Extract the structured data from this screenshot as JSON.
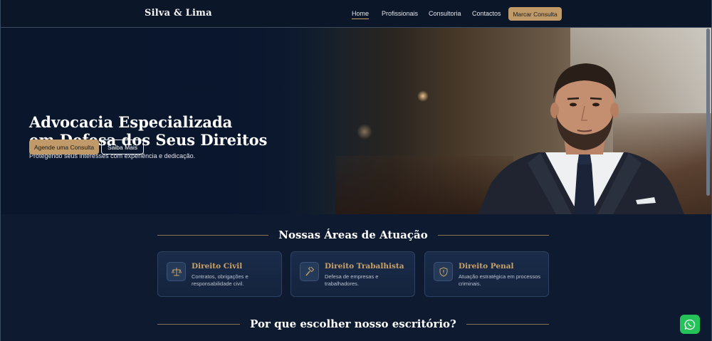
{
  "nav": {
    "brand": "Silva & Lima",
    "links": [
      {
        "label": "Home",
        "active": true
      },
      {
        "label": "Profissionais",
        "active": false
      },
      {
        "label": "Consultoria",
        "active": false
      },
      {
        "label": "Contactos",
        "active": false
      }
    ],
    "cta": "Marcar Consulta"
  },
  "hero": {
    "title_line1": "Advocacia Especializada",
    "title_line2": "em Defesa dos Seus Direitos",
    "subtitle": "Protegendo seus interesses com experiência e dedicação.",
    "primary_button": "Agende uma Consulta",
    "secondary_button": "Saiba Mais"
  },
  "areas": {
    "heading": "Nossas Áreas de Atuação",
    "cards": [
      {
        "icon": "scales-icon",
        "title": "Direito Civil",
        "description": "Contratos, obrigações e responsabilidade civil."
      },
      {
        "icon": "gavel-icon",
        "title": "Direito Trabalhista",
        "description": "Defesa de empresas e trabalhadores."
      },
      {
        "icon": "shield-icon",
        "title": "Direito Penal",
        "description": "Atuação estratégica em processos criminais."
      }
    ]
  },
  "why": {
    "heading": "Por que escolher nosso escritório?"
  },
  "colors": {
    "accent": "#c09a68",
    "background": "#0d1a30",
    "whatsapp": "#25c25a"
  }
}
